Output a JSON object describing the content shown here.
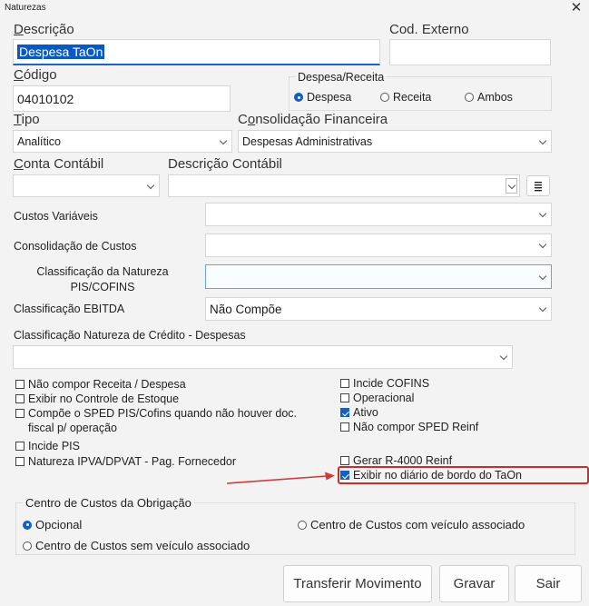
{
  "window": {
    "title": "Naturezas",
    "close_glyph": "✕"
  },
  "descricao": {
    "label_u": "D",
    "label_rest": "escrição",
    "value": "Despesa TaOn"
  },
  "cod_externo": {
    "label": "Cod. Externo",
    "value": ""
  },
  "codigo": {
    "label_u": "C",
    "label_rest": "ódigo",
    "value": "04010102"
  },
  "despesa_receita": {
    "label": "Despesa/Receita",
    "options": [
      "Despesa",
      "Receita",
      "Ambos"
    ],
    "selected": "Despesa"
  },
  "tipo": {
    "label_u": "T",
    "label_rest": "ipo",
    "value": "Analítico"
  },
  "consolidacao_financeira": {
    "label_pre": "C",
    "label_u": "o",
    "label_rest": "nsolidação Financeira",
    "value": "Despesas Administrativas"
  },
  "conta_contabil": {
    "label_u": "C",
    "label_rest": "onta Contábil",
    "value": ""
  },
  "descricao_contabil": {
    "label": "Descrição Contábil",
    "value": ""
  },
  "custos_variaveis": {
    "label": "Custos Variáveis",
    "value": ""
  },
  "consolidacao_custos": {
    "label": "Consolidação de Custos",
    "value": ""
  },
  "classificacao_pis": {
    "label_line1": "Classificação da Natureza",
    "label_line2": "PIS/COFINS",
    "value": ""
  },
  "classificacao_ebitda": {
    "label": "Classificação EBITDA",
    "value": "Não Compõe"
  },
  "classificacao_credito": {
    "label": "Classificação Natureza de Crédito - Despesas",
    "value": ""
  },
  "checkboxes_left": [
    {
      "label": "Não compor Receita / Despesa",
      "checked": false
    },
    {
      "label": "Exibir no Controle de Estoque",
      "checked": false
    },
    {
      "label": "Compõe o SPED PIS/Cofins quando não houver doc.",
      "label2": "fiscal p/ operação",
      "checked": false
    },
    {
      "label": "Incide PIS",
      "checked": false
    },
    {
      "label": "Natureza IPVA/DPVAT - Pag. Fornecedor",
      "checked": false
    }
  ],
  "checkboxes_right": [
    {
      "label": "Incide COFINS",
      "checked": false
    },
    {
      "label": "Operacional",
      "checked": false
    },
    {
      "label": "Ativo",
      "checked": true
    },
    {
      "label": "Não compor SPED Reinf",
      "checked": false
    },
    {
      "label": "Gerar R-4000 Reinf",
      "checked": false
    },
    {
      "label": "Exibir no diário de bordo do TaOn",
      "checked": true
    }
  ],
  "centro_custos": {
    "label": "Centro de Custos da Obrigação",
    "options": [
      "Opcional",
      "Centro de Custos com veículo associado",
      "Centro de Custos sem veículo associado"
    ],
    "selected": "Opcional"
  },
  "buttons": {
    "transferir": "Transferir Movimento",
    "gravar": "Gravar",
    "sair": "Sair"
  },
  "colors": {
    "accent": "#0f5fc6",
    "highlight": "#cf2b2b",
    "arrow": "#d23a3a"
  }
}
